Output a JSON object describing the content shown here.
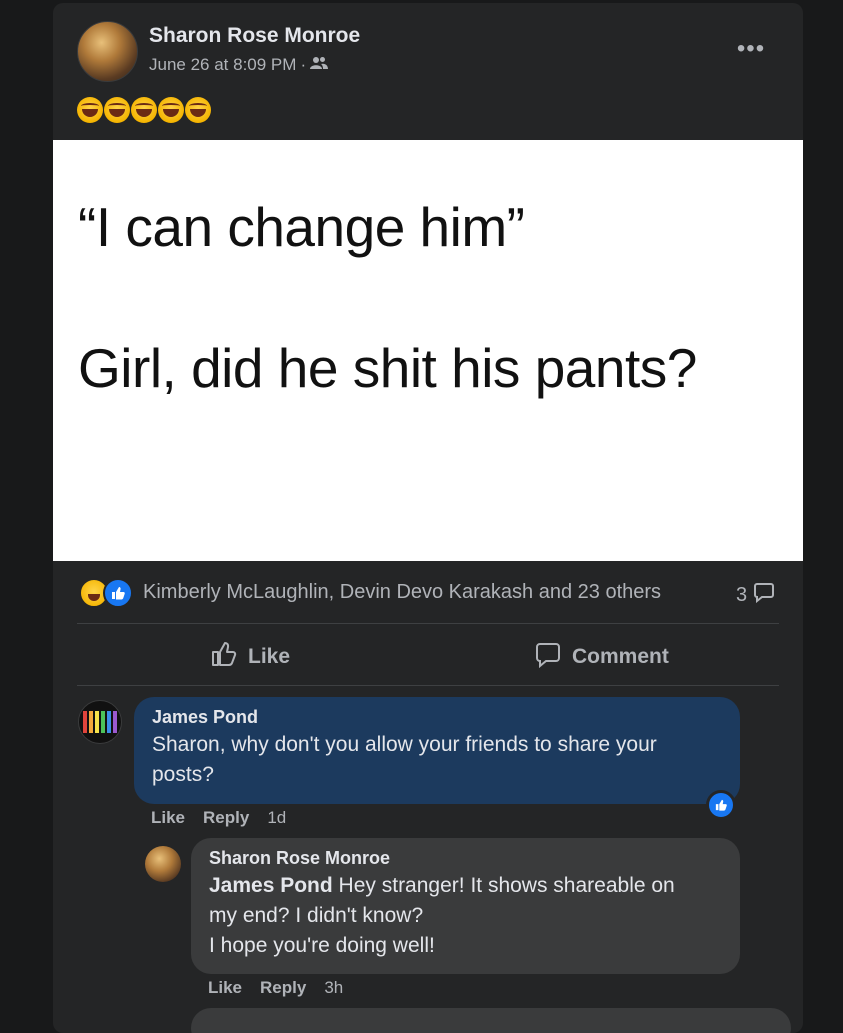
{
  "post": {
    "author": "Sharon Rose Monroe",
    "timestamp": "June 26 at 8:09 PM",
    "separator": "·",
    "audience_icon": "friends-icon",
    "more_label": "•••",
    "caption_emojis": [
      "rolling-on-floor-laughing-emoji",
      "rolling-on-floor-laughing-emoji",
      "rolling-on-floor-laughing-emoji",
      "rolling-on-floor-laughing-emoji",
      "rolling-on-floor-laughing-emoji"
    ],
    "image_text": {
      "line1": "“I can change him”",
      "line2": "Girl, did he shit his pants?"
    }
  },
  "reactions": {
    "types": [
      "haha",
      "like"
    ],
    "names": "Kimberly McLaughlin, Devin Devo Karakash and 23 others",
    "comment_count": "3"
  },
  "actions": {
    "like_label": "Like",
    "comment_label": "Comment"
  },
  "comments": [
    {
      "author": "James Pond",
      "text": "Sharon, why don't you allow your friends to share your\nposts?",
      "like_label": "Like",
      "reply_label": "Reply",
      "time": "1d",
      "reaction": "like"
    },
    {
      "author": "Sharon Rose Monroe",
      "mention": "James Pond",
      "text": " Hey stranger! It shows shareable on\nmy end? I didn't know?\nI hope you're doing well!",
      "like_label": "Like",
      "reply_label": "Reply",
      "time": "3h"
    }
  ],
  "colors": {
    "background": "#18191a",
    "card": "#242526",
    "bubble_highlight": "#1c3a5e",
    "bubble": "#3a3b3c",
    "accent": "#1877f2",
    "secondary_text": "#b0b3b8"
  }
}
